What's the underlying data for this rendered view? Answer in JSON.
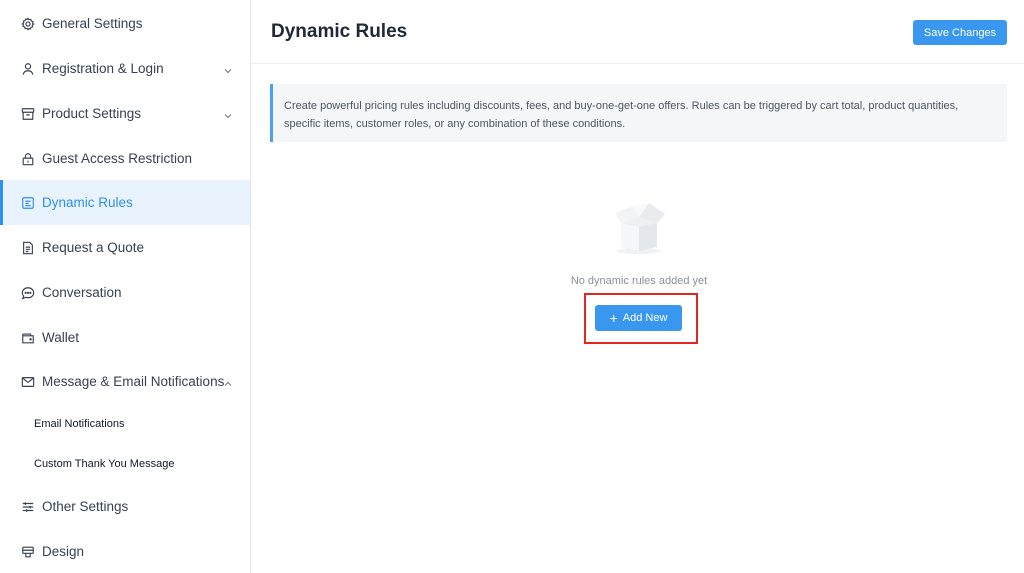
{
  "sidebar": {
    "items": [
      {
        "label": "General Settings",
        "icon": "gear-icon"
      },
      {
        "label": "Registration & Login",
        "icon": "user-icon",
        "chevron": "down"
      },
      {
        "label": "Product Settings",
        "icon": "box-icon",
        "chevron": "down"
      },
      {
        "label": "Guest Access Restriction",
        "icon": "lock-icon"
      },
      {
        "label": "Dynamic Rules",
        "icon": "rules-icon",
        "active": true
      },
      {
        "label": "Request a Quote",
        "icon": "document-icon"
      },
      {
        "label": "Conversation",
        "icon": "chat-icon"
      },
      {
        "label": "Wallet",
        "icon": "wallet-icon"
      },
      {
        "label": "Message & Email Notifications",
        "icon": "envelope-icon",
        "chevron": "up"
      },
      {
        "label": "Other Settings",
        "icon": "sliders-icon"
      },
      {
        "label": "Design",
        "icon": "design-icon"
      }
    ],
    "sub_items": [
      {
        "label": "Email Notifications"
      },
      {
        "label": "Custom Thank You Message"
      }
    ]
  },
  "header": {
    "title": "Dynamic Rules",
    "save_label": "Save Changes"
  },
  "info": {
    "text": "Create powerful pricing rules including discounts, fees, and buy-one-get-one offers. Rules can be triggered by cart total, product quantities, specific items, customer roles, or any combination of these conditions."
  },
  "empty_state": {
    "message": "No dynamic rules added yet",
    "add_label": "Add New",
    "add_icon": "plus-icon"
  },
  "colors": {
    "accent": "#3a97f0",
    "active_bg": "#e8f3fe",
    "highlight": "#e3261f"
  }
}
